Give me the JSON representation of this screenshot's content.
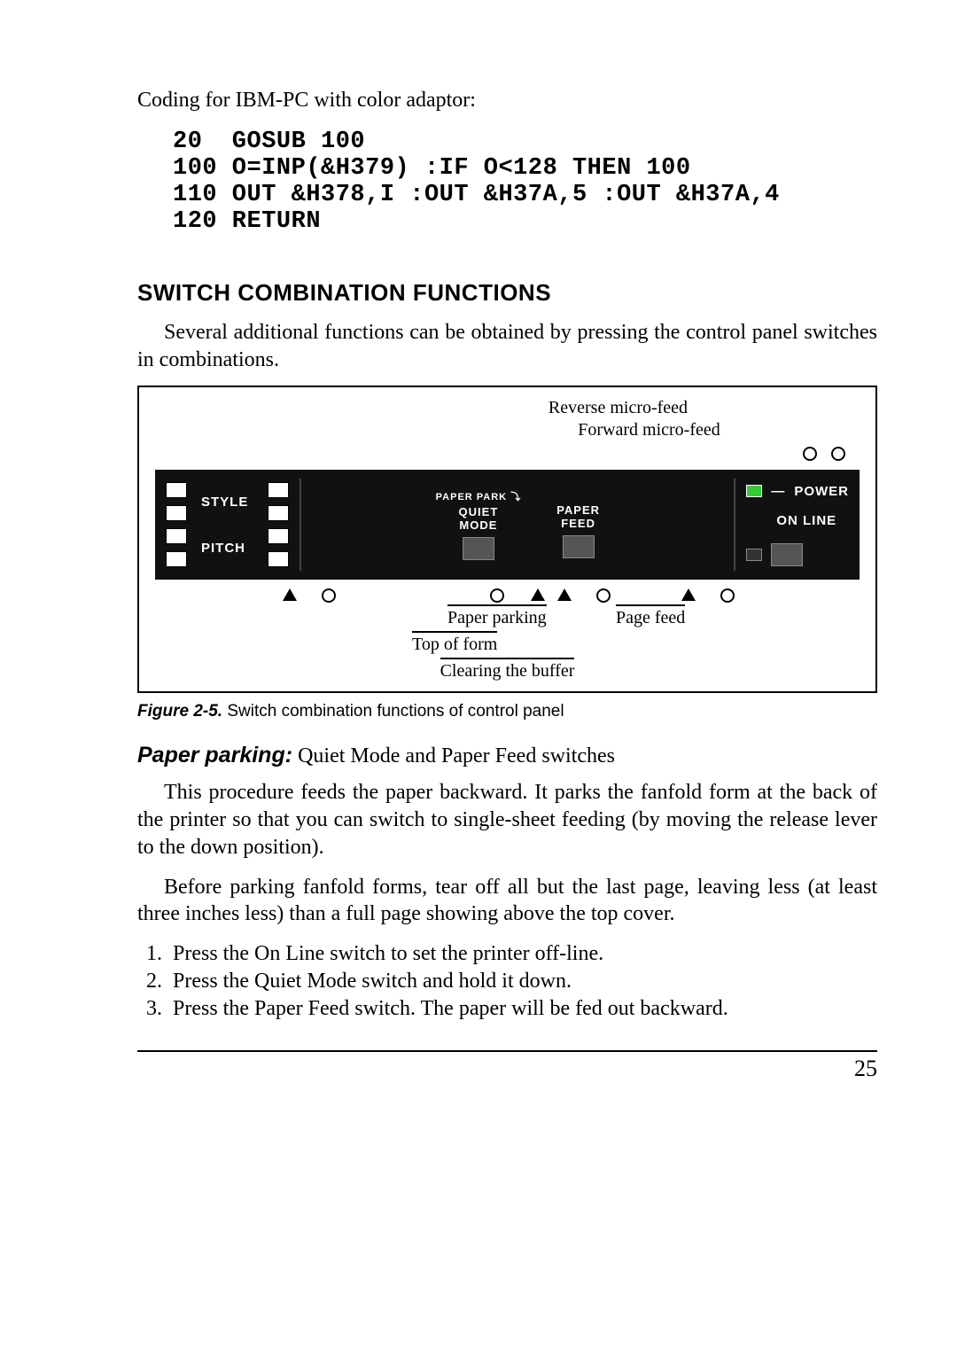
{
  "intro": "Coding for IBM-PC with color adaptor:",
  "code_lines": [
    "20  GOSUB 100",
    "100 O=INP(&H379) :IF O<128 THEN 100",
    "110 OUT &H378,I :OUT &H37A,5 :OUT &H37A,4",
    "120 RETURN"
  ],
  "heading": "SWITCH COMBINATION FUNCTIONS",
  "heading_para": "Several additional functions can be obtained by pressing the control panel switches in combinations.",
  "figure": {
    "reverse_label": "Reverse micro-feed",
    "forward_label": "Forward micro-feed",
    "panel": {
      "style": "STYLE",
      "pitch": "PITCH",
      "paper_park": "PAPER PARK",
      "quiet_mode_line1": "QUIET",
      "quiet_mode_line2": "MODE",
      "paper_feed_line1": "PAPER",
      "paper_feed_line2": "FEED",
      "power": "POWER",
      "online": "ON LINE"
    },
    "bottom": {
      "paper_parking": "Paper parking",
      "page_feed": "Page feed",
      "top_of_form": "Top of form",
      "clearing_buffer": "Clearing the buffer"
    },
    "caption_label": "Figure 2-5.",
    "caption_text": " Switch combination functions of control panel"
  },
  "paper_parking": {
    "head_bold": "Paper parking:",
    "head_rest": " Quiet Mode and Paper Feed switches",
    "para1": "This procedure feeds the paper backward. It parks the fanfold form at the back of the printer so that you can switch to single-sheet feeding (by moving the release lever to the down position).",
    "para2": "Before parking fanfold forms, tear off all but the last page, leaving less (at least three inches less) than a full page showing above the top cover.",
    "steps": [
      "Press the On Line switch to set the printer off-line.",
      "Press the Quiet Mode switch and hold it down.",
      "Press the Paper Feed switch. The paper will be fed out backward."
    ]
  },
  "page_number": "25"
}
